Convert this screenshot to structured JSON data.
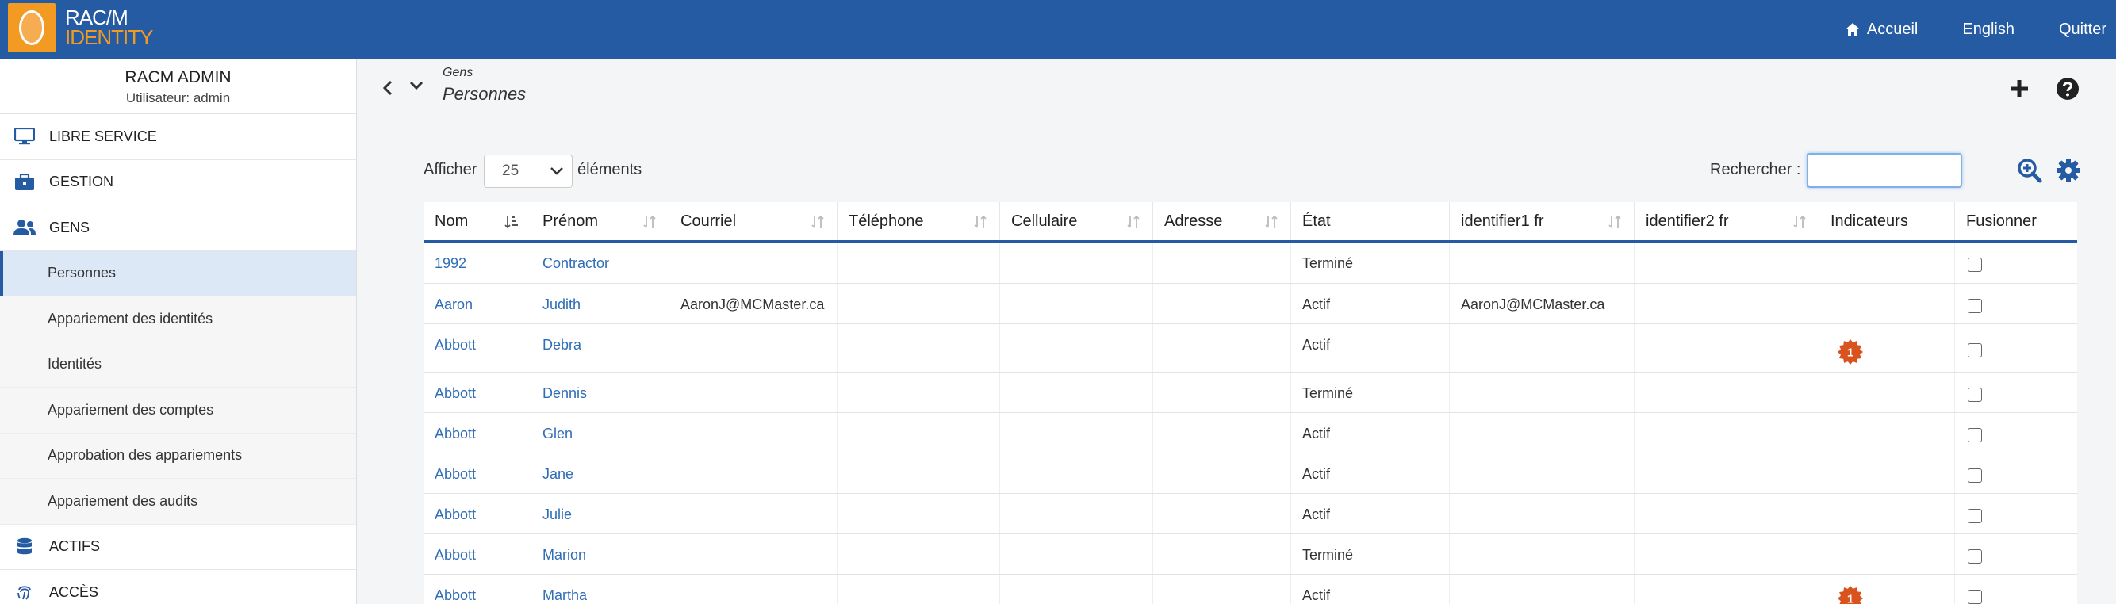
{
  "app": {
    "logo_line1": "RAC/M",
    "logo_line2": "IDENTITY"
  },
  "topnav": {
    "home": "Accueil",
    "language": "English",
    "logout": "Quitter"
  },
  "sidebar": {
    "title": "RACM ADMIN",
    "user": "Utilisateur: admin",
    "sections": [
      {
        "label": "LIBRE SERVICE",
        "icon": "desktop-icon"
      },
      {
        "label": "GESTION",
        "icon": "briefcase-icon"
      },
      {
        "label": "GENS",
        "icon": "users-icon"
      }
    ],
    "subitems": [
      "Personnes",
      "Appariement des identités",
      "Identités",
      "Appariement des comptes",
      "Approbation des appariements",
      "Appariement des audits"
    ],
    "sections_after": [
      {
        "label": "ACTIFS",
        "icon": "database-icon"
      },
      {
        "label": "ACCÈS",
        "icon": "fingerprint-icon"
      }
    ]
  },
  "header": {
    "breadcrumb_parent": "Gens",
    "breadcrumb_current": "Personnes"
  },
  "controls": {
    "show_label": "Afficher",
    "page_size": "25",
    "elements_label": "éléments",
    "search_label": "Rechercher :",
    "search_value": ""
  },
  "table": {
    "columns": [
      "Nom",
      "Prénom",
      "Courriel",
      "Téléphone",
      "Cellulaire",
      "Adresse",
      "État",
      "identifier1 fr",
      "identifier2 fr",
      "Indicateurs",
      "Fusionner"
    ],
    "rows": [
      {
        "nom": "1992",
        "prenom": "Contractor",
        "courriel": "",
        "telephone": "",
        "cellulaire": "",
        "adresse": "",
        "etat": "Terminé",
        "id1": "",
        "id2": "",
        "indicator": ""
      },
      {
        "nom": "Aaron",
        "prenom": "Judith",
        "courriel": "AaronJ@MCMaster.ca",
        "telephone": "",
        "cellulaire": "",
        "adresse": "",
        "etat": "Actif",
        "id1": "AaronJ@MCMaster.ca",
        "id2": "",
        "indicator": ""
      },
      {
        "nom": "Abbott",
        "prenom": "Debra",
        "courriel": "",
        "telephone": "",
        "cellulaire": "",
        "adresse": "",
        "etat": "Actif",
        "id1": "",
        "id2": "",
        "indicator": "1"
      },
      {
        "nom": "Abbott",
        "prenom": "Dennis",
        "courriel": "",
        "telephone": "",
        "cellulaire": "",
        "adresse": "",
        "etat": "Terminé",
        "id1": "",
        "id2": "",
        "indicator": ""
      },
      {
        "nom": "Abbott",
        "prenom": "Glen",
        "courriel": "",
        "telephone": "",
        "cellulaire": "",
        "adresse": "",
        "etat": "Actif",
        "id1": "",
        "id2": "",
        "indicator": ""
      },
      {
        "nom": "Abbott",
        "prenom": "Jane",
        "courriel": "",
        "telephone": "",
        "cellulaire": "",
        "adresse": "",
        "etat": "Actif",
        "id1": "",
        "id2": "",
        "indicator": ""
      },
      {
        "nom": "Abbott",
        "prenom": "Julie",
        "courriel": "",
        "telephone": "",
        "cellulaire": "",
        "adresse": "",
        "etat": "Actif",
        "id1": "",
        "id2": "",
        "indicator": ""
      },
      {
        "nom": "Abbott",
        "prenom": "Marion",
        "courriel": "",
        "telephone": "",
        "cellulaire": "",
        "adresse": "",
        "etat": "Terminé",
        "id1": "",
        "id2": "",
        "indicator": ""
      },
      {
        "nom": "Abbott",
        "prenom": "Martha",
        "courriel": "",
        "telephone": "",
        "cellulaire": "",
        "adresse": "",
        "etat": "Actif",
        "id1": "",
        "id2": "",
        "indicator": "1"
      }
    ]
  },
  "colors": {
    "brand": "#245ba3",
    "accent": "#f29a21",
    "link": "#2f6db5",
    "badge": "#d9531e"
  }
}
